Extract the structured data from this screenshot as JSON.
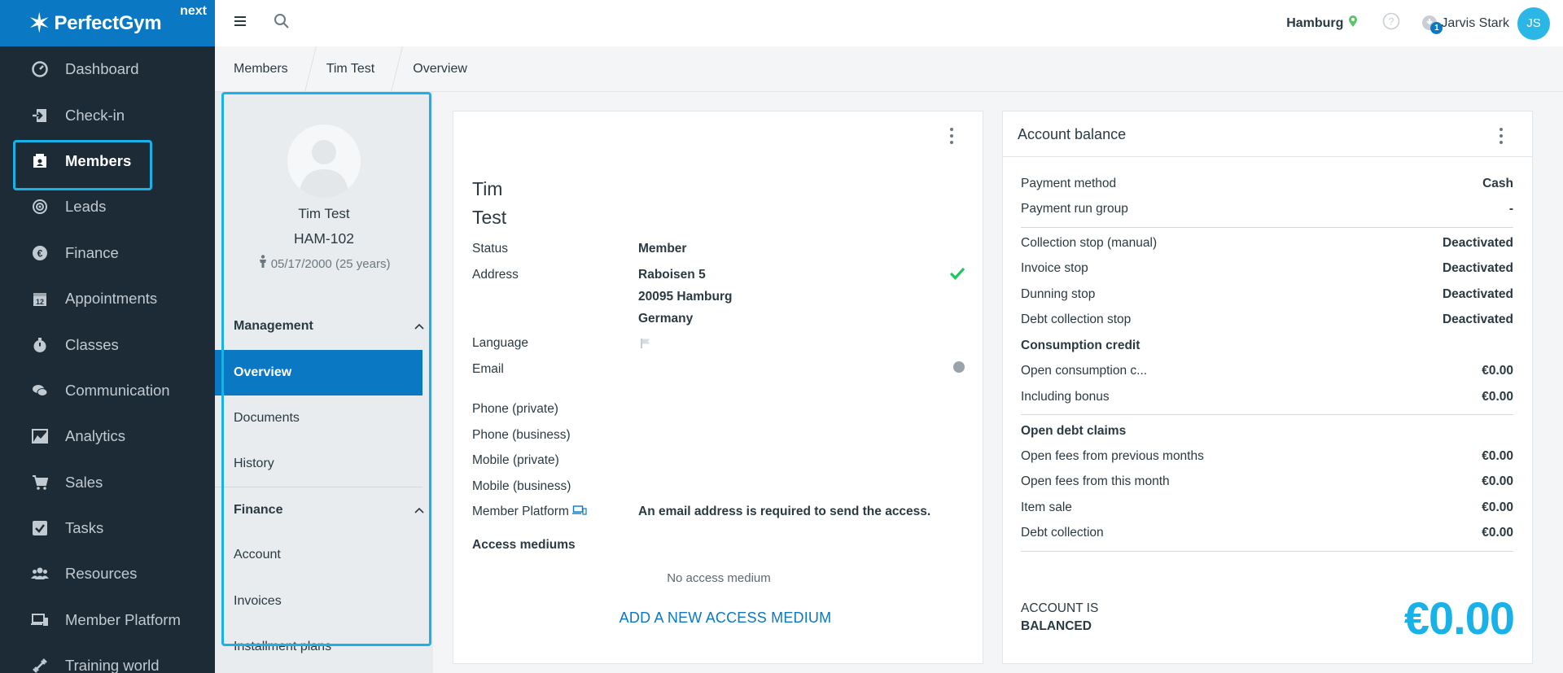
{
  "app": {
    "brand": "PerfectGym",
    "brand_suffix": "next"
  },
  "nav": [
    {
      "label": "Dashboard",
      "icon": "dashboard-icon"
    },
    {
      "label": "Check-in",
      "icon": "check-in-icon"
    },
    {
      "label": "Members",
      "icon": "members-icon",
      "active": true
    },
    {
      "label": "Leads",
      "icon": "leads-icon"
    },
    {
      "label": "Finance",
      "icon": "finance-icon"
    },
    {
      "label": "Appointments",
      "icon": "calendar-icon"
    },
    {
      "label": "Classes",
      "icon": "timer-icon"
    },
    {
      "label": "Communication",
      "icon": "chat-icon"
    },
    {
      "label": "Analytics",
      "icon": "chart-icon"
    },
    {
      "label": "Sales",
      "icon": "cart-icon"
    },
    {
      "label": "Tasks",
      "icon": "task-check-icon"
    },
    {
      "label": "Resources",
      "icon": "people-icon"
    },
    {
      "label": "Member Platform",
      "icon": "devices-icon"
    },
    {
      "label": "Training world",
      "icon": "dumbbell-icon"
    }
  ],
  "topbar": {
    "location": "Hamburg",
    "notifications": "1",
    "user_name": "Jarvis Stark",
    "user_initials": "JS"
  },
  "breadcrumb": [
    "Members",
    "Tim Test",
    "Overview"
  ],
  "member": {
    "name": "Tim Test",
    "id": "HAM-102",
    "birth": "05/17/2000 (25 years)",
    "sections": [
      {
        "title": "Management",
        "links": [
          "Overview",
          "Documents",
          "History"
        ]
      },
      {
        "title": "Finance",
        "links": [
          "Account",
          "Invoices",
          "Installment plans"
        ]
      }
    ]
  },
  "personal": {
    "first_name": "Tim",
    "last_name": "Test",
    "status_label": "Status",
    "status_value": "Member",
    "address_label": "Address",
    "address_lines": [
      "Raboisen 5",
      "20095 Hamburg",
      "Germany"
    ],
    "language_label": "Language",
    "email_label": "Email",
    "phone_private": "Phone (private)",
    "phone_business": "Phone (business)",
    "mobile_private": "Mobile (private)",
    "mobile_business": "Mobile (business)",
    "member_platform_label": "Member Platform",
    "member_platform_value": "An email address is required to send the access.",
    "access_mediums_label": "Access mediums",
    "no_access_medium": "No access medium",
    "add_access_medium": "ADD A NEW ACCESS MEDIUM"
  },
  "account": {
    "title": "Account balance",
    "rows": [
      {
        "label": "Payment method",
        "value": "Cash"
      },
      {
        "label": "Payment run group",
        "value": "-"
      },
      {
        "label": "Collection stop (manual)",
        "value": "Deactivated"
      },
      {
        "label": "Invoice stop",
        "value": "Deactivated"
      },
      {
        "label": "Dunning stop",
        "value": "Deactivated"
      },
      {
        "label": "Debt collection stop",
        "value": "Deactivated"
      },
      {
        "label": "Consumption credit",
        "value": ""
      },
      {
        "label": "Open consumption c...",
        "value": "€0.00"
      },
      {
        "label": "Including bonus",
        "value": "€0.00"
      },
      {
        "label": "Open debt claims",
        "value": ""
      },
      {
        "label": "Open fees from previous months",
        "value": "€0.00"
      },
      {
        "label": "Open fees from this month",
        "value": "€0.00"
      },
      {
        "label": "Item sale",
        "value": "€0.00"
      },
      {
        "label": "Debt collection",
        "value": "€0.00"
      }
    ],
    "balance_status_line1": "ACCOUNT IS",
    "balance_status_line2": "BALANCED",
    "balance_amount": "€0.00",
    "accent": "#18b1e8"
  },
  "colors": {
    "nav_bg": "#1c2b36",
    "primary": "#0a78c2",
    "highlight": "#18b1e8",
    "success": "#22c55e"
  }
}
